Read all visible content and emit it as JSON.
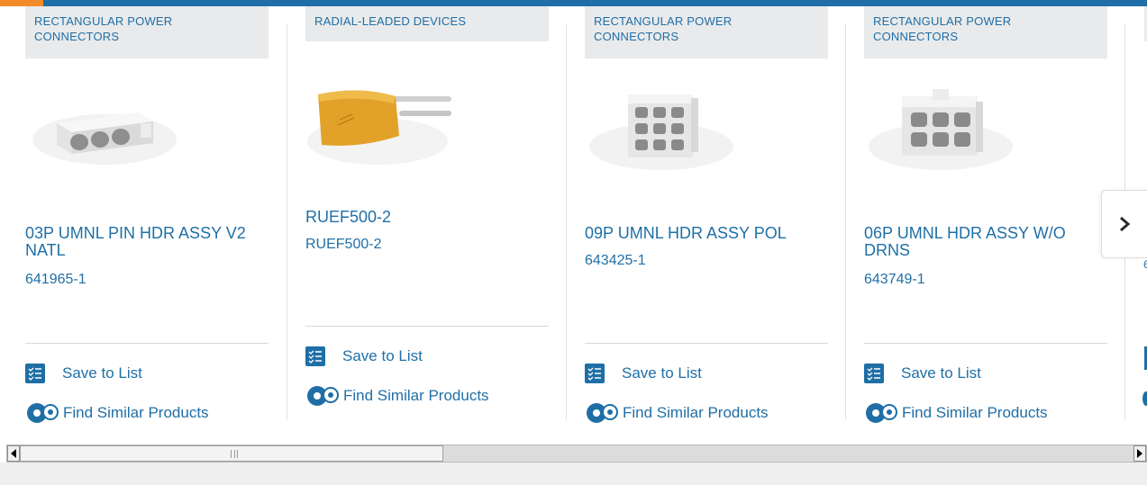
{
  "colors": {
    "brand_blue": "#1f6fa6",
    "accent_orange": "#f28c28",
    "category_bg": "#e9eaeb"
  },
  "cards": [
    {
      "category": "RECTANGULAR POWER CONNECTORS",
      "title": "03P UMNL PIN HDR ASSY V2 NATL",
      "part_number": "641965-1",
      "save_label": "Save to List",
      "find_label": "Find Similar Products",
      "image": "3-position-connector"
    },
    {
      "category": "RADIAL-LEADED DEVICES",
      "title": "RUEF500-2",
      "part_number": "RUEF500-2",
      "save_label": "Save to List",
      "find_label": "Find Similar Products",
      "image": "radial-leaded-fuse"
    },
    {
      "category": "RECTANGULAR POWER CONNECTORS",
      "title": "09P UMNL HDR ASSY POL",
      "part_number": "643425-1",
      "save_label": "Save to List",
      "find_label": "Find Similar Products",
      "image": "9-position-connector"
    },
    {
      "category": "RECTANGULAR POWER CONNECTORS",
      "title": "06P UMNL HDR ASSY W/O DRNS",
      "part_number": "643749-1",
      "save_label": "Save to List",
      "find_label": "Find Similar Products",
      "image": "6-position-connector"
    }
  ],
  "partial_card": {
    "part_number_fragment": "6"
  },
  "carousel": {
    "next_icon": "chevron-right-icon"
  },
  "scrollbar": {
    "left_icon": "triangle-left-icon",
    "right_icon": "triangle-right-icon"
  }
}
